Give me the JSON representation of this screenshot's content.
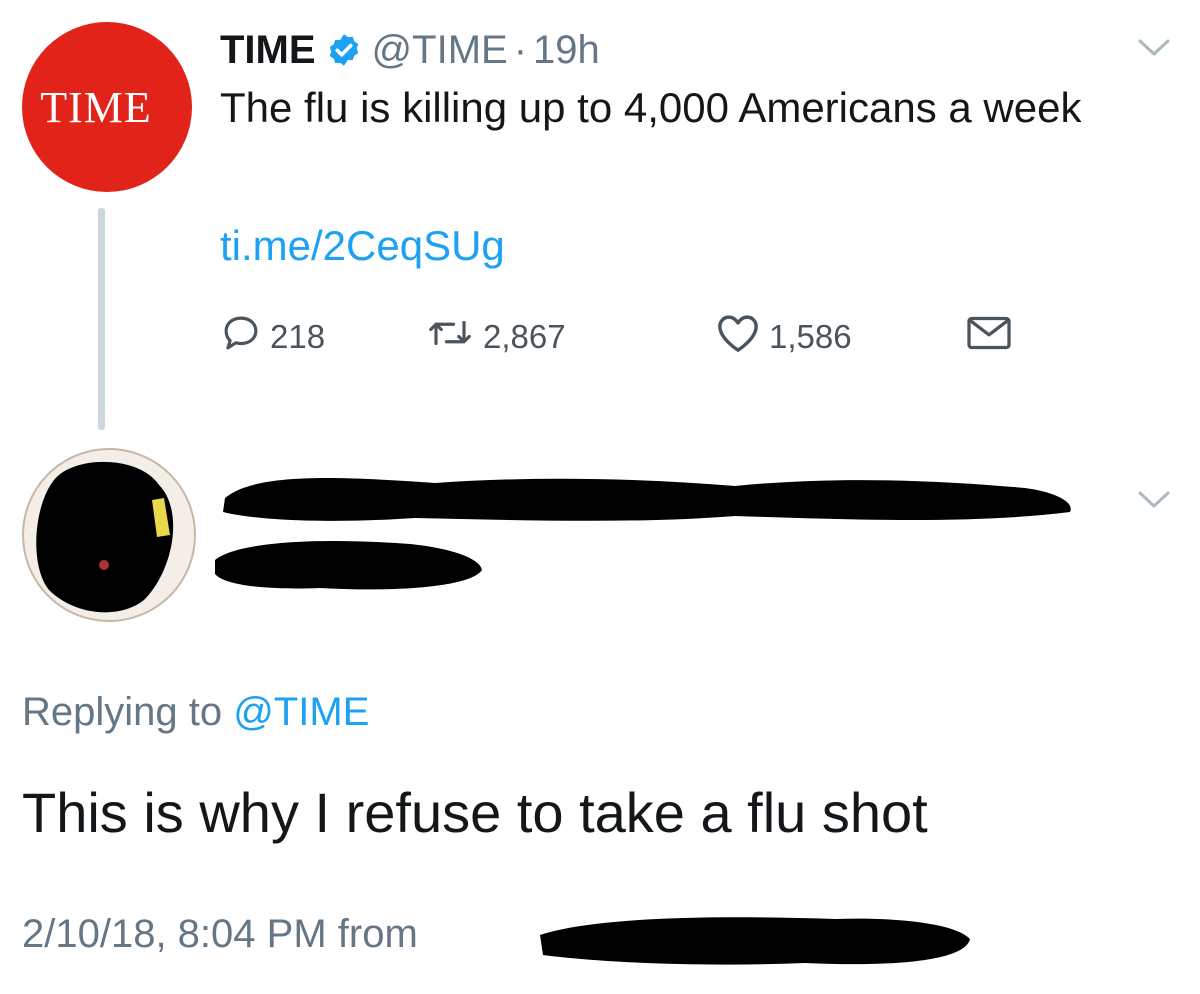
{
  "original_tweet": {
    "avatar_text": "TIME",
    "name": "TIME",
    "handle": "@TIME",
    "separator": "·",
    "time_ago": "19h",
    "text": "The flu is killing up to 4,000 Americans a week",
    "link": "ti.me/2CeqSUg",
    "reply_count": "218",
    "retweet_count": "2,867",
    "like_count": "1,586"
  },
  "reply_tweet": {
    "replying_label": "Replying to",
    "replying_handle": "@TIME",
    "text": "This is why I refuse to take a flu shot",
    "timestamp": "2/10/18, 8:04 PM from"
  },
  "colors": {
    "time_red": "#e2231a",
    "link_blue": "#1da1f2",
    "muted_gray": "#657786",
    "redaction": "#000000"
  },
  "icons": {
    "verified": "verified-badge-icon",
    "reply": "reply-icon",
    "retweet": "retweet-icon",
    "like": "heart-icon",
    "message": "envelope-icon",
    "menu": "chevron-down-icon"
  }
}
